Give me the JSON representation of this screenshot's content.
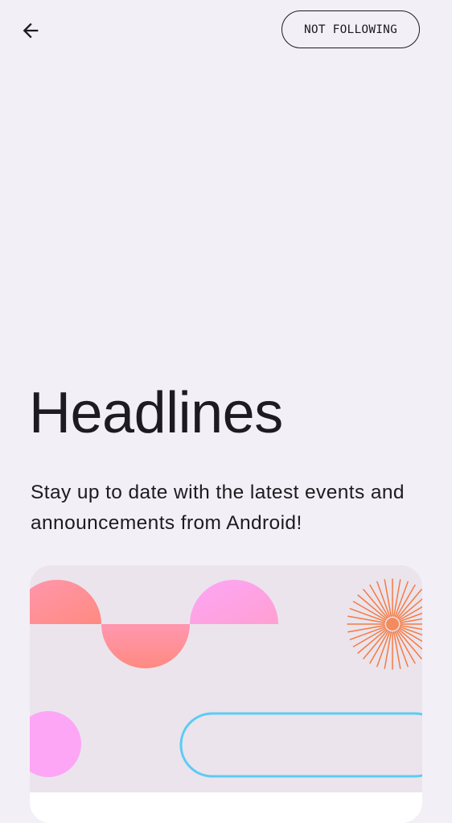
{
  "top_bar": {
    "back_icon": "arrow-back-icon",
    "follow_button_label": "NOT FOLLOWING"
  },
  "topic": {
    "title": "Headlines",
    "description": "Stay up to date with the latest events and announcements from Android!"
  },
  "colors": {
    "background": "#f3eff6",
    "text": "#1d1b20",
    "card_art_background": "#ebe4ec",
    "shape_salmon": "#ff8a80",
    "shape_pink": "#fda2e6",
    "shape_magenta": "#fda6f6",
    "burst_orange": "#f47b45",
    "outline_blue": "#5ccbf4"
  }
}
